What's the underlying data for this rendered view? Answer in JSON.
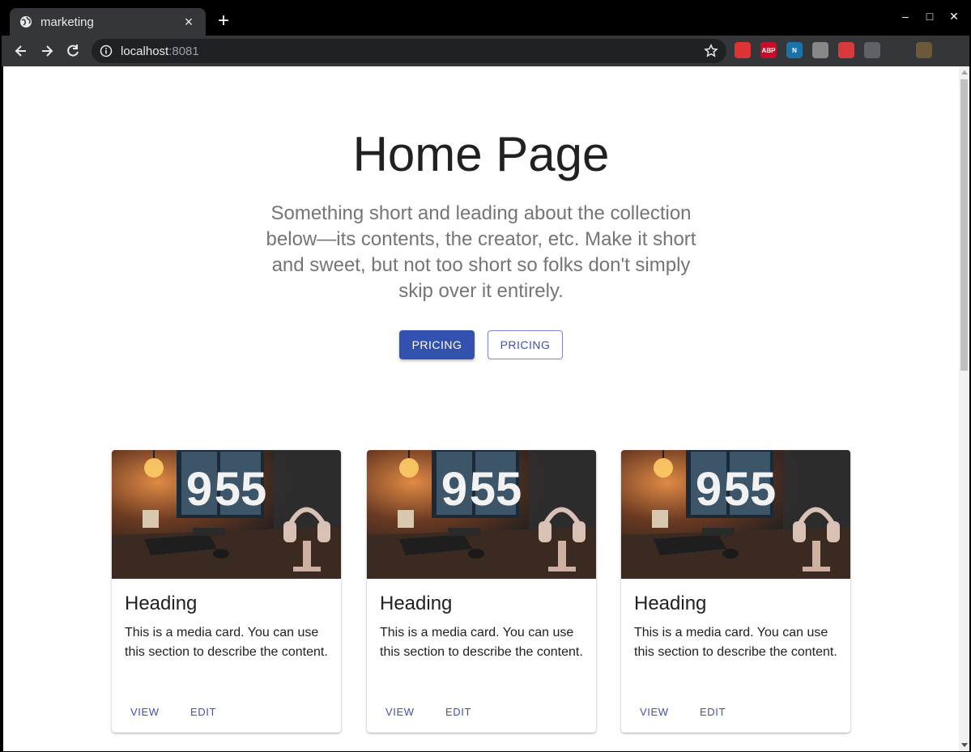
{
  "browser": {
    "tab_title": "marketing",
    "tab_close": "×",
    "new_tab": "+",
    "url_host": "localhost",
    "url_port": ":8081",
    "window_controls": {
      "minimize": "–",
      "maximize": "□",
      "close": "✕"
    },
    "extensions": [
      {
        "name": "santa-extension-icon",
        "label": "",
        "color": "#d33"
      },
      {
        "name": "adblock-plus-icon",
        "label": "ABP",
        "color": "#c70d2c"
      },
      {
        "name": "n-extension-icon",
        "label": "N",
        "color": "#1a73a8"
      },
      {
        "name": "cloud-extension-icon",
        "label": "",
        "color": "#888"
      },
      {
        "name": "red-extension-icon",
        "label": "",
        "color": "#d63a3a"
      },
      {
        "name": "s-extension-icon",
        "label": "",
        "color": "#5f6368"
      },
      {
        "name": "puzzle-extensions-icon",
        "label": "",
        "color": "#35363a"
      },
      {
        "name": "profile-avatar-icon",
        "label": "",
        "color": "#6b5a3a"
      }
    ]
  },
  "hero": {
    "title": "Home Page",
    "description": "Something short and leading about the collection below—its contents, the creator, etc. Make it short and sweet, but not too short so folks don't simply skip over it entirely.",
    "primary_button": "PRICING",
    "secondary_button": "PRICING"
  },
  "cards": [
    {
      "heading": "Heading",
      "text": "This is a media card. You can use this section to describe the content.",
      "view": "VIEW",
      "edit": "EDIT",
      "clock_hours": "9",
      "clock_minutes": "55"
    },
    {
      "heading": "Heading",
      "text": "This is a media card. You can use this section to describe the content.",
      "view": "VIEW",
      "edit": "EDIT",
      "clock_hours": "9",
      "clock_minutes": "55"
    },
    {
      "heading": "Heading",
      "text": "This is a media card. You can use this section to describe the content.",
      "view": "VIEW",
      "edit": "EDIT",
      "clock_hours": "9",
      "clock_minutes": "55"
    }
  ],
  "colors": {
    "primary": "#3f51b5",
    "chrome_dark": "#35363a"
  }
}
